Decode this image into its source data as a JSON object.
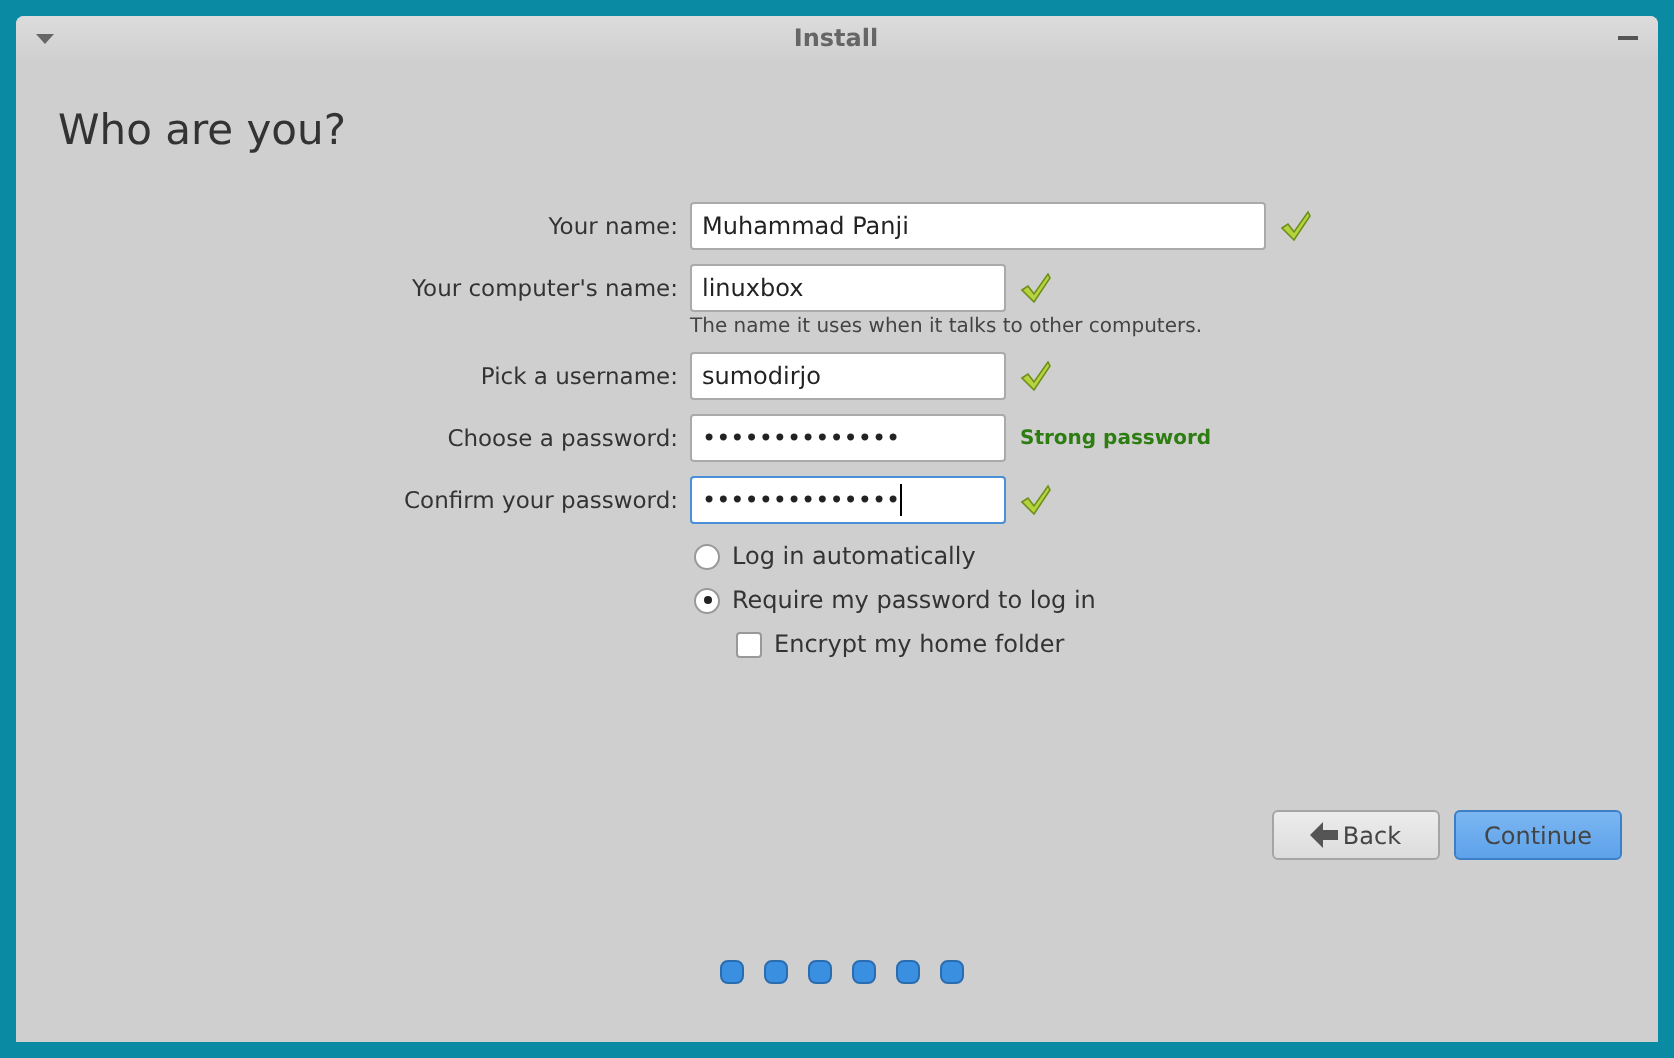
{
  "window": {
    "title": "Install"
  },
  "heading": "Who are you?",
  "fields": [
    {
      "label": "Your name:",
      "value": "Muhammad Panji",
      "wide": true,
      "focused": false,
      "status": {
        "kind": "check"
      }
    },
    {
      "label": "Your computer's name:",
      "value": "linuxbox",
      "wide": false,
      "focused": false,
      "status": {
        "kind": "check"
      },
      "hint": "The name it uses when it talks to other computers."
    },
    {
      "label": "Pick a username:",
      "value": "sumodirjo",
      "wide": false,
      "focused": false,
      "status": {
        "kind": "check"
      }
    },
    {
      "label": "Choose a password:",
      "value": "••••••••••••••",
      "wide": false,
      "focused": false,
      "status": {
        "kind": "text",
        "text": "Strong password"
      }
    },
    {
      "label": "Confirm your password:",
      "value": "••••••••••••••",
      "wide": false,
      "focused": true,
      "status": {
        "kind": "check"
      }
    }
  ],
  "login_options": [
    {
      "label": "Log in automatically",
      "selected": false
    },
    {
      "label": "Require my password to log in",
      "selected": true
    }
  ],
  "encrypt": {
    "label": "Encrypt my home folder",
    "checked": false
  },
  "buttons": [
    {
      "kind": "back",
      "label": "Back"
    },
    {
      "kind": "primary",
      "label": "Continue"
    }
  ]
}
